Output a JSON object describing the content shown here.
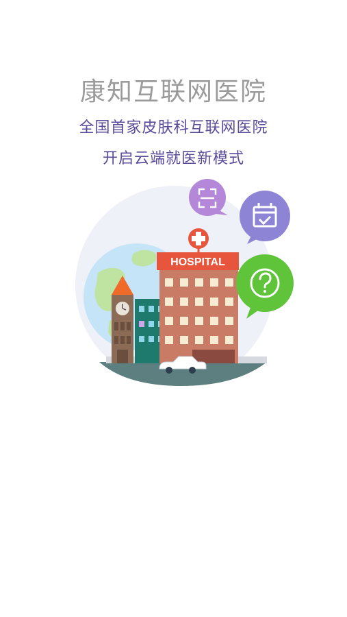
{
  "splash": {
    "title": "康知互联网医院",
    "subtitle_line1": "全国首家皮肤科互联网医院",
    "subtitle_line2": "开启云端就医新模式"
  },
  "illustration": {
    "hospital_sign": "HOSPITAL",
    "icons": [
      "scan-icon",
      "calendar-check-icon",
      "question-icon",
      "medical-cross-icon"
    ],
    "colors": {
      "title_gray": "#9b9b9b",
      "subtitle_purple": "#5a4a9a",
      "hospital_sign_red": "#e8553d",
      "scan_bubble_purple": "#b487d8",
      "calendar_bubble_purple": "#8d84d6",
      "question_bubble_green": "#5fc43a"
    }
  }
}
